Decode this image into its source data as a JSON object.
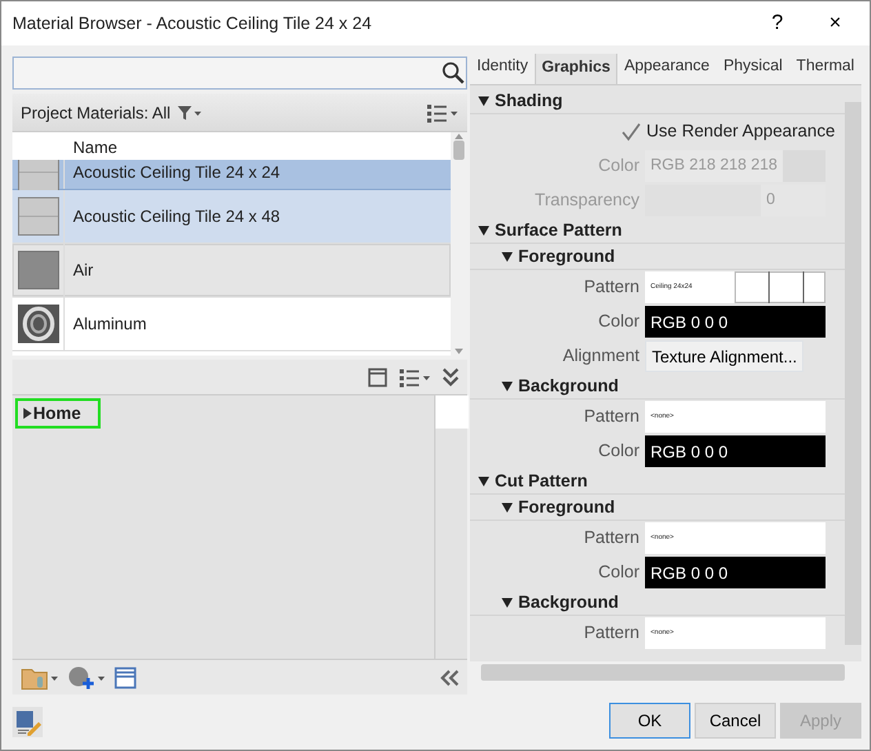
{
  "window": {
    "title": "Material Browser - Acoustic Ceiling Tile 24 x 24",
    "help": "?",
    "close": "×"
  },
  "library_header": {
    "label": "Project Materials: All"
  },
  "materials": {
    "column": "Name",
    "rows": [
      {
        "name": "Acoustic Ceiling Tile 24 x 24",
        "kind": "tile",
        "selected": true,
        "focused": true,
        "hovered": false
      },
      {
        "name": "Acoustic Ceiling Tile 24 x 48",
        "kind": "tile",
        "selected": true,
        "focused": false,
        "hovered": false
      },
      {
        "name": "Air",
        "kind": "gray",
        "selected": false,
        "focused": false,
        "hovered": true
      },
      {
        "name": "Aluminum",
        "kind": "metal",
        "selected": false,
        "focused": false,
        "hovered": false
      }
    ]
  },
  "tree": [
    {
      "label": "Home",
      "expanded": false,
      "highlighted": true
    }
  ],
  "tabs": [
    {
      "label": "Identity",
      "selected": false
    },
    {
      "label": "Graphics",
      "selected": true
    },
    {
      "label": "Appearance",
      "selected": false
    },
    {
      "label": "Physical",
      "selected": false
    },
    {
      "label": "Thermal",
      "selected": false
    }
  ],
  "sections": [
    {
      "title": "Shading",
      "expanded": true,
      "rows": [
        {
          "kind": "checkbox",
          "label": "Use Render Appearance",
          "checked": true
        },
        {
          "kind": "swatch",
          "label": "Color",
          "value": "RGB 218 218 218",
          "disabled": true
        },
        {
          "kind": "number",
          "label": "Transparency",
          "value": "0",
          "disabled": true
        }
      ]
    },
    {
      "title": "Surface Pattern",
      "expanded": true,
      "children": [
        {
          "title": "Foreground",
          "expanded": true,
          "rows": [
            {
              "kind": "pattern",
              "label": "Pattern",
              "value": "Ceiling 24x24",
              "grid": true
            },
            {
              "kind": "color",
              "label": "Color",
              "value": "RGB 0 0 0"
            },
            {
              "kind": "button",
              "label": "Alignment",
              "value": "Texture Alignment..."
            }
          ]
        },
        {
          "title": "Background",
          "expanded": true,
          "rows": [
            {
              "kind": "pattern",
              "label": "Pattern",
              "value": "<none>",
              "grid": false
            },
            {
              "kind": "color",
              "label": "Color",
              "value": "RGB 0 0 0"
            }
          ]
        }
      ]
    },
    {
      "title": "Cut Pattern",
      "expanded": true,
      "children": [
        {
          "title": "Foreground",
          "expanded": true,
          "rows": [
            {
              "kind": "pattern",
              "label": "Pattern",
              "value": "<none>",
              "grid": false
            },
            {
              "kind": "color",
              "label": "Color",
              "value": "RGB 0 0 0"
            }
          ]
        },
        {
          "title": "Background",
          "expanded": true,
          "rows": [
            {
              "kind": "pattern",
              "label": "Pattern",
              "value": "<none>",
              "grid": false
            }
          ]
        }
      ]
    }
  ],
  "buttons": [
    {
      "label": "OK",
      "default": true,
      "disabled": false
    },
    {
      "label": "Cancel",
      "default": false,
      "disabled": false
    },
    {
      "label": "Apply",
      "default": false,
      "disabled": true
    }
  ]
}
